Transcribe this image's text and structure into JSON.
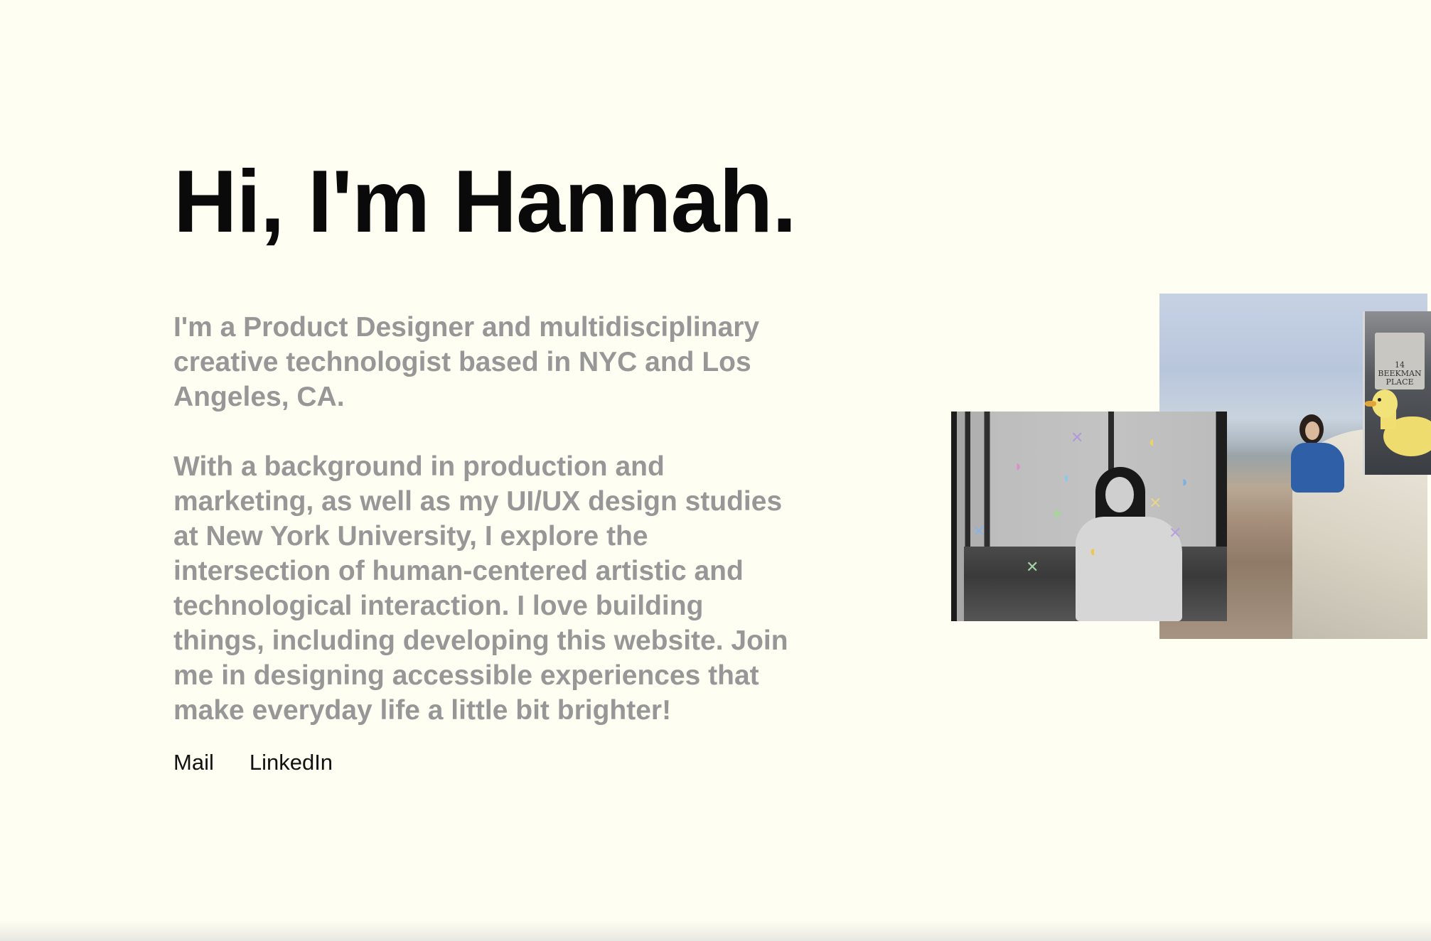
{
  "hero": {
    "title": "Hi, I'm Hannah."
  },
  "bio": {
    "paragraph_1": "I'm a Product Designer and multidisciplinary creative technologist based in NYC and Los Angeles, CA.",
    "paragraph_2": "With a background in production and marketing, as well as my UI/UX design studies at New York University, I explore the intersection of human-centered artistic and technological interaction. I love building things, including developing this website. Join me in designing accessible experiences that make everyday life a little bit brighter!"
  },
  "links": {
    "mail": "Mail",
    "linkedin": "LinkedIn"
  },
  "photos": {
    "sign_text": "14\nBEEKMAN\nPLACE"
  },
  "colors": {
    "background": "#fefef2",
    "heading": "#0a0a0a",
    "body_text": "#979797",
    "link_text": "#111111"
  }
}
